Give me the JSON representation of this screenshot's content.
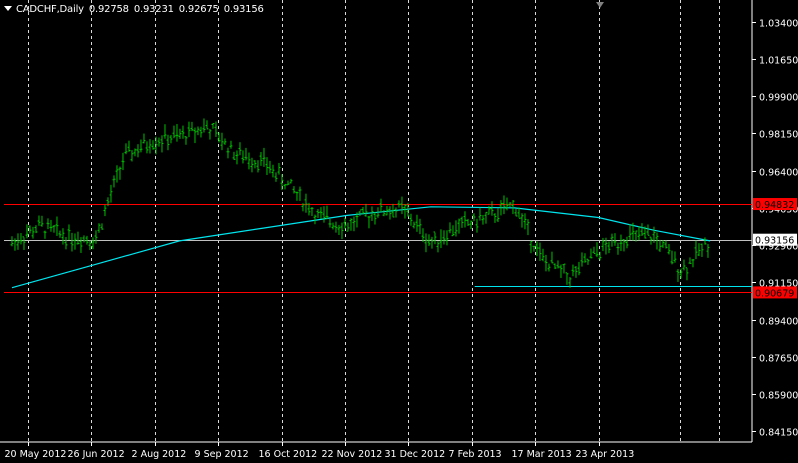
{
  "header": {
    "symbol_timeframe": "CADCHF,Daily",
    "open": "0.92758",
    "high": "0.93231",
    "low": "0.92675",
    "close": "0.93156"
  },
  "colors": {
    "background": "#000000",
    "candles": "#00c000",
    "moving_average": "#00e5ee",
    "support_resistance": "#ff0000",
    "current_price_line": "#c0c0c0",
    "grid": "#ffffff",
    "axis_text": "#ffffff"
  },
  "icons": [
    "dropdown-arrow-icon",
    "chart-shift-marker-icon"
  ],
  "chart_data": {
    "type": "line",
    "title": "CADCHF,Daily",
    "xlabel": "",
    "ylabel": "",
    "ylim": [
      0.8365,
      1.0442
    ],
    "grid": true,
    "x_tick_labels": [
      "20 May 2012",
      "26 Jun 2012",
      "2 Aug 2012",
      "9 Sep 2012",
      "16 Oct 2012",
      "22 Nov 2012",
      "31 Dec 2012",
      "7 Feb 2013",
      "17 Mar 2013",
      "23 Apr 2013"
    ],
    "y_tick_labels": [
      "1.03400",
      "1.01650",
      "0.99900",
      "0.98150",
      "0.96400",
      "0.94650",
      "0.92900",
      "0.91150",
      "0.89400",
      "0.87650",
      "0.85900",
      "0.84150"
    ],
    "y_tick_values": [
      1.034,
      1.0165,
      0.999,
      0.9815,
      0.964,
      0.9465,
      0.929,
      0.9115,
      0.894,
      0.8765,
      0.859,
      0.8415
    ],
    "series": [
      {
        "name": "",
        "kind": "daily-bars",
        "x": [
          "2012-05-14",
          "2012-05-28",
          "2012-06-11",
          "2012-06-25",
          "2012-07-09",
          "2012-07-23",
          "2012-08-06",
          "2012-08-20",
          "2012-09-03",
          "2012-09-17",
          "2012-10-01",
          "2012-10-15",
          "2012-10-29",
          "2012-11-12",
          "2012-11-26",
          "2012-12-10",
          "2012-12-24",
          "2013-01-07",
          "2013-01-21",
          "2013-02-04",
          "2013-02-18",
          "2013-03-04",
          "2013-03-18",
          "2013-04-01",
          "2013-04-15",
          "2013-04-29"
        ],
        "values": [
          0.93,
          0.938,
          0.933,
          0.932,
          0.97,
          0.978,
          0.98,
          0.985,
          0.972,
          0.968,
          0.956,
          0.942,
          0.938,
          0.945,
          0.946,
          0.93,
          0.938,
          0.942,
          0.948,
          0.922,
          0.914,
          0.926,
          0.933,
          0.933,
          0.917,
          0.9316
        ]
      },
      {
        "name": "",
        "kind": "moving-average",
        "x": [
          "2012-05-14",
          "2012-06-25",
          "2012-08-06",
          "2012-09-17",
          "2012-10-29",
          "2012-12-10",
          "2013-01-21",
          "2013-03-04",
          "2013-04-01",
          "2013-04-29"
        ],
        "values": [
          0.909,
          0.92,
          0.931,
          0.937,
          0.943,
          0.947,
          0.9465,
          0.942,
          0.936,
          0.931
        ]
      }
    ],
    "horizontal_lines": [
      {
        "label": "0.94832",
        "value": 0.94832,
        "color": "#ff0000",
        "x_start": "2012-05-14",
        "x_end": "2013-04-29",
        "badge": true
      },
      {
        "label": "0.90679",
        "value": 0.90679,
        "color": "#ff0000",
        "x_start": "2012-05-14",
        "x_end": "2013-04-29",
        "badge": true
      },
      {
        "label": "0.93156",
        "value": 0.93156,
        "color": "#c0c0c0",
        "x_start": "2012-05-14",
        "x_end": "2013-04-29",
        "badge": true
      },
      {
        "label": "",
        "value": 0.91,
        "color": "#00e5ee",
        "x_start": "2013-01-01",
        "x_end": "2013-04-29",
        "badge": false
      }
    ]
  }
}
